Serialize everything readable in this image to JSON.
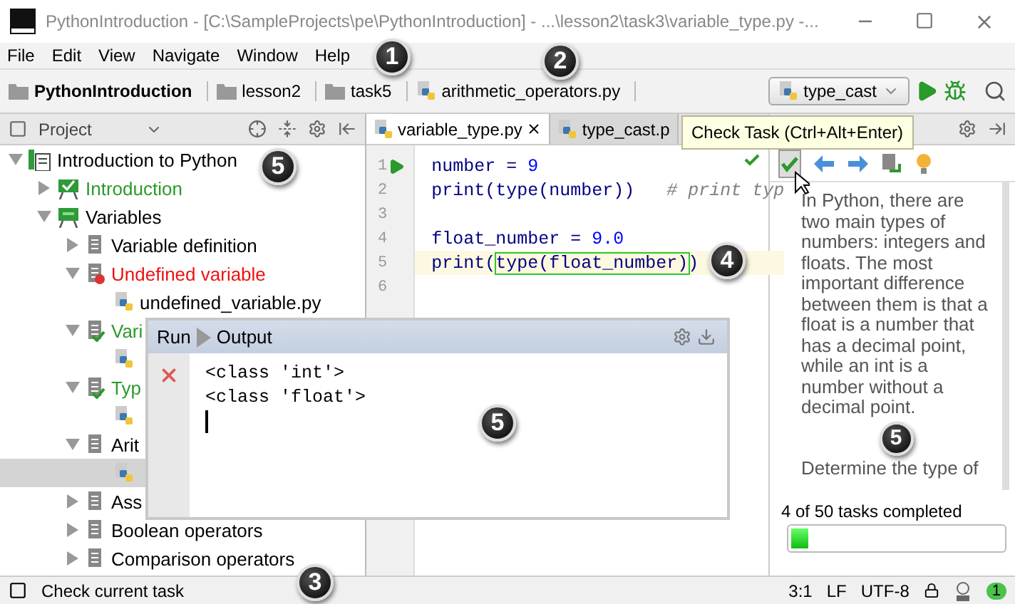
{
  "window": {
    "title": "PythonIntroduction - [C:\\SampleProjects\\pe\\PythonIntroduction] - ...\\lesson2\\task3\\variable_type.py -..."
  },
  "menu": [
    "File",
    "Edit",
    "View",
    "Navigate",
    "Window",
    "Help"
  ],
  "breadcrumbs": [
    {
      "label": "PythonIntroduction",
      "kind": "project"
    },
    {
      "label": "lesson2",
      "kind": "folder"
    },
    {
      "label": "task5",
      "kind": "folder"
    },
    {
      "label": "arithmetic_operators.py",
      "kind": "file"
    }
  ],
  "run_config": "type_cast",
  "project_panel": {
    "title": "Project",
    "tree": [
      {
        "label": "Introduction to Python",
        "kind": "course",
        "expanded": true,
        "selected": false,
        "children": [
          {
            "label": "Introduction",
            "kind": "lesson",
            "solved": true,
            "expanded": false,
            "selected": false
          },
          {
            "label": "Variables",
            "kind": "lesson",
            "solved": false,
            "expanded": true,
            "selected": false,
            "children": [
              {
                "label": "Variable definition",
                "kind": "task",
                "solved": false,
                "failed": false,
                "expanded": false,
                "selected": false
              },
              {
                "label": "Undefined variable",
                "kind": "task",
                "solved": false,
                "failed": true,
                "expanded": true,
                "selected": false,
                "children": [
                  {
                    "label": "undefined_variable.py",
                    "kind": "file",
                    "selected": false
                  }
                ]
              },
              {
                "label": "Vari",
                "kind": "task",
                "solved": true,
                "failed": false,
                "expanded": true,
                "selected": false,
                "children": [
                  {
                    "kind": "file",
                    "selected": false
                  }
                ]
              },
              {
                "label": "Typ",
                "kind": "task",
                "solved": true,
                "failed": false,
                "expanded": true,
                "selected": false,
                "children": [
                  {
                    "kind": "file",
                    "selected": false
                  }
                ]
              },
              {
                "label": "Arit",
                "kind": "task",
                "solved": false,
                "failed": false,
                "expanded": true,
                "selected": false,
                "children": [
                  {
                    "kind": "file",
                    "selected": true
                  }
                ]
              },
              {
                "label": "Ass",
                "kind": "task",
                "solved": false,
                "failed": false,
                "expanded": false,
                "selected": false
              },
              {
                "label": "Boolean operators",
                "kind": "task",
                "solved": false,
                "failed": false,
                "expanded": false,
                "selected": false
              },
              {
                "label": "Comparison operators",
                "kind": "task",
                "solved": false,
                "failed": false,
                "expanded": false,
                "selected": false
              }
            ]
          }
        ]
      }
    ]
  },
  "editor": {
    "tabs": [
      {
        "label": "variable_type.py",
        "selected": true
      },
      {
        "label": "type_cast.p",
        "selected": false
      }
    ],
    "lines": [
      {
        "number": "1",
        "current": false,
        "runnable": true,
        "segments": [
          {
            "text": "number = ",
            "kind": "code"
          },
          {
            "text": "9",
            "kind": "number"
          }
        ]
      },
      {
        "number": "2",
        "current": false,
        "runnable": false,
        "segments": [
          {
            "text": "print(type(number))   ",
            "kind": "code"
          },
          {
            "text": "# print typ",
            "kind": "comment"
          }
        ]
      },
      {
        "number": "3",
        "current": false,
        "runnable": false
      },
      {
        "number": "4",
        "current": false,
        "runnable": false,
        "segments": [
          {
            "text": "float_number = ",
            "kind": "code"
          },
          {
            "text": "9.0",
            "kind": "number"
          }
        ]
      },
      {
        "number": "5",
        "current": true,
        "runnable": false,
        "segments": [
          {
            "text": "print(",
            "kind": "code"
          },
          {
            "text": "type(float_number)",
            "kind": "answer"
          },
          {
            "text": ")",
            "kind": "code"
          }
        ]
      },
      {
        "number": "6",
        "current": false,
        "runnable": false
      }
    ]
  },
  "tooltip": "Check Task (Ctrl+Alt+Enter)",
  "task_panel": {
    "paragraphs": [
      "In Python, there are two main types of numbers: integers and floats. The most important difference between them is that a float is a number that has a decimal point, while an int is a number without a decimal point.",
      "Determine the type of"
    ],
    "progress": {
      "label": "4 of 50 tasks completed",
      "level": 0.08
    }
  },
  "run_window": {
    "title": "Run",
    "tab": "Output",
    "output": [
      "<class 'int'>",
      "<class 'float'>"
    ]
  },
  "status_bar": {
    "message": "Check current task",
    "position": "3:1",
    "line_separator": "LF",
    "encoding": "UTF-8",
    "notifications": "1"
  },
  "callouts": [
    {
      "number": "1",
      "kind": "title"
    },
    {
      "number": "2",
      "kind": "navigation"
    },
    {
      "number": "5",
      "kind": "project"
    },
    {
      "number": "4",
      "kind": "editor"
    },
    {
      "number": "5",
      "kind": "run"
    },
    {
      "number": "5",
      "kind": "task"
    },
    {
      "number": "3",
      "kind": "status"
    }
  ]
}
